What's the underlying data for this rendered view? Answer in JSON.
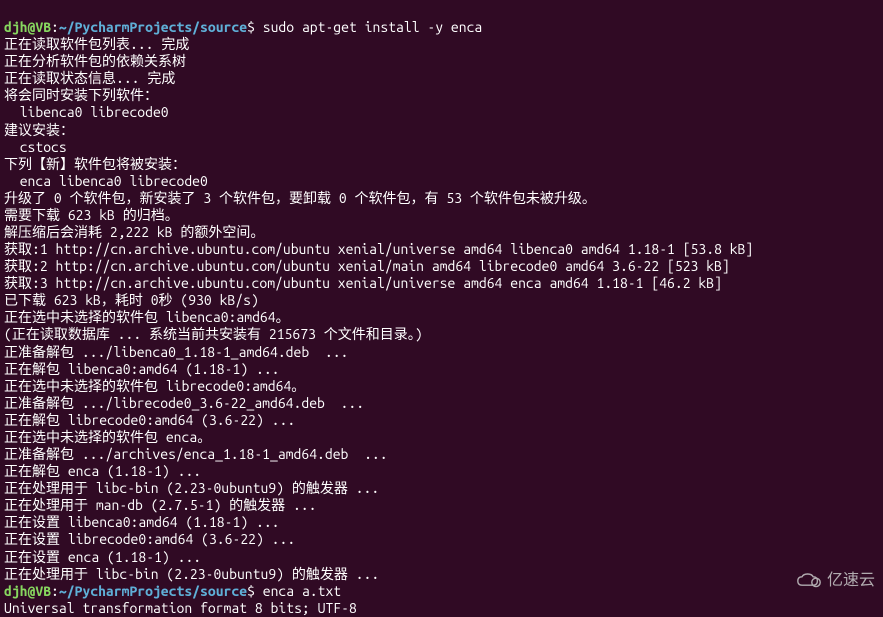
{
  "prompt1": {
    "user_host": "djh@VB",
    "colon": ":",
    "path": "~/PycharmProjects/source",
    "dollar": "$ ",
    "command": "sudo apt-get install -y enca"
  },
  "output": [
    "正在读取软件包列表... 完成",
    "正在分析软件包的依赖关系树       ",
    "正在读取状态信息... 完成       ",
    "将会同时安装下列软件：",
    "  libenca0 librecode0",
    "建议安装：",
    "  cstocs",
    "下列【新】软件包将被安装：",
    "  enca libenca0 librecode0",
    "升级了 0 个软件包，新安装了 3 个软件包，要卸载 0 个软件包，有 53 个软件包未被升级。",
    "需要下载 623 kB 的归档。",
    "解压缩后会消耗 2,222 kB 的额外空间。",
    "获取:1 http://cn.archive.ubuntu.com/ubuntu xenial/universe amd64 libenca0 amd64 1.18-1 [53.8 kB]",
    "获取:2 http://cn.archive.ubuntu.com/ubuntu xenial/main amd64 librecode0 amd64 3.6-22 [523 kB]",
    "获取:3 http://cn.archive.ubuntu.com/ubuntu xenial/universe amd64 enca amd64 1.18-1 [46.2 kB]",
    "已下载 623 kB，耗时 0秒 (930 kB/s)",
    "正在选中未选择的软件包 libenca0:amd64。",
    "(正在读取数据库 ... 系统当前共安装有 215673 个文件和目录。)",
    "正准备解包 .../libenca0_1.18-1_amd64.deb  ...",
    "正在解包 libenca0:amd64 (1.18-1) ...",
    "正在选中未选择的软件包 librecode0:amd64。",
    "正准备解包 .../librecode0_3.6-22_amd64.deb  ...",
    "正在解包 librecode0:amd64 (3.6-22) ...",
    "正在选中未选择的软件包 enca。",
    "正准备解包 .../archives/enca_1.18-1_amd64.deb  ...",
    "正在解包 enca (1.18-1) ...",
    "正在处理用于 libc-bin (2.23-0ubuntu9) 的触发器 ...",
    "正在处理用于 man-db (2.7.5-1) 的触发器 ...",
    "正在设置 libenca0:amd64 (1.18-1) ...",
    "正在设置 librecode0:amd64 (3.6-22) ...",
    "正在设置 enca (1.18-1) ...",
    "正在处理用于 libc-bin (2.23-0ubuntu9) 的触发器 ..."
  ],
  "prompt2": {
    "user_host": "djh@VB",
    "colon": ":",
    "path": "~/PycharmProjects/source",
    "dollar": "$ ",
    "command": "enca a.txt"
  },
  "output2": [
    "Universal transformation format 8 bits; UTF-8"
  ],
  "watermark": {
    "text": "亿速云"
  }
}
